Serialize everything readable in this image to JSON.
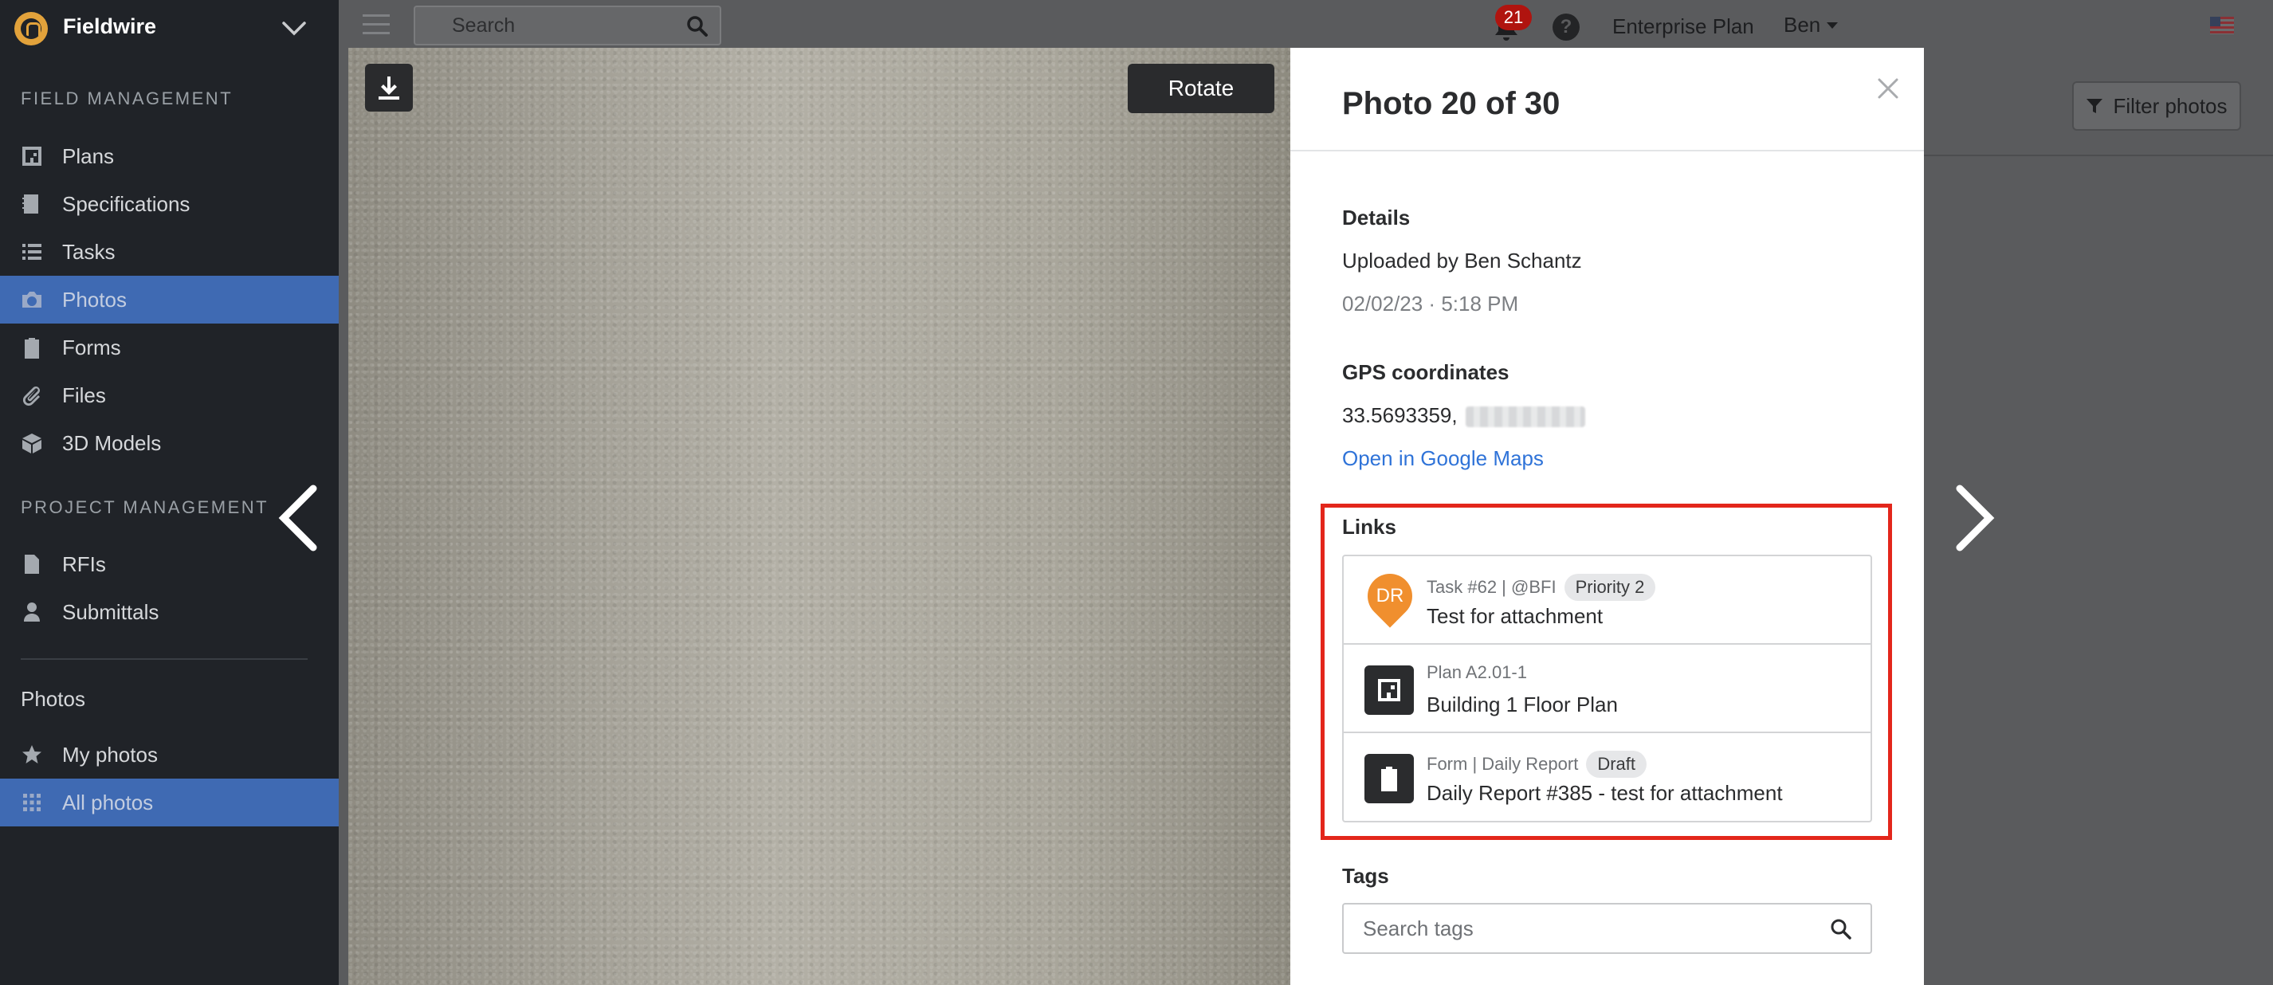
{
  "app": {
    "name": "Fieldwire"
  },
  "sidebar": {
    "section_field": "FIELD MANAGEMENT",
    "field_items": [
      {
        "label": "Plans",
        "icon": "plans-icon"
      },
      {
        "label": "Specifications",
        "icon": "specifications-icon"
      },
      {
        "label": "Tasks",
        "icon": "tasks-icon"
      },
      {
        "label": "Photos",
        "icon": "camera-icon",
        "active": true
      },
      {
        "label": "Forms",
        "icon": "clipboard-icon"
      },
      {
        "label": "Files",
        "icon": "paperclip-icon"
      },
      {
        "label": "3D Models",
        "icon": "cube-icon"
      }
    ],
    "section_project": "PROJECT MANAGEMENT",
    "project_items": [
      {
        "label": "RFIs",
        "icon": "rfi-icon"
      },
      {
        "label": "Submittals",
        "icon": "submittals-icon"
      }
    ],
    "photos_heading": "Photos",
    "photo_items": [
      {
        "label": "My photos",
        "icon": "star-icon"
      },
      {
        "label": "All photos",
        "icon": "grid-icon",
        "active": true
      }
    ]
  },
  "topbar": {
    "search_placeholder": "Search",
    "notifications_count": "21",
    "help_label": "?",
    "plan_label": "Enterprise Plan",
    "user_name": "Ben"
  },
  "page": {
    "filter_label": "Filter photos"
  },
  "modal": {
    "rotate_label": "Rotate",
    "title": "Photo 20 of 30",
    "details_label": "Details",
    "uploaded_by": "Uploaded by Ben Schantz",
    "timestamp": "02/02/23 · 5:18 PM",
    "gps_label": "GPS coordinates",
    "gps_value": "33.5693359,",
    "maps_link": "Open in Google Maps",
    "links_label": "Links",
    "links": [
      {
        "meta": "Task #62 | @BFI",
        "badge": "Priority 2",
        "title": "Test for attachment",
        "icon": "task-pin-icon",
        "avatar": "DR",
        "avatar_color": "#f08f2e"
      },
      {
        "meta": "Plan A2.01-1",
        "badge": "",
        "title": "Building 1 Floor Plan",
        "icon": "plan-icon"
      },
      {
        "meta": "Form | Daily Report",
        "badge": "Draft",
        "title": "Daily Report #385 - test for attachment",
        "icon": "form-icon"
      }
    ],
    "tags_label": "Tags",
    "tags_placeholder": "Search tags"
  },
  "colors": {
    "accent": "#3f6ab3",
    "highlight": "#e3261b",
    "link": "#2f73d8",
    "badge": "#b0140f"
  }
}
